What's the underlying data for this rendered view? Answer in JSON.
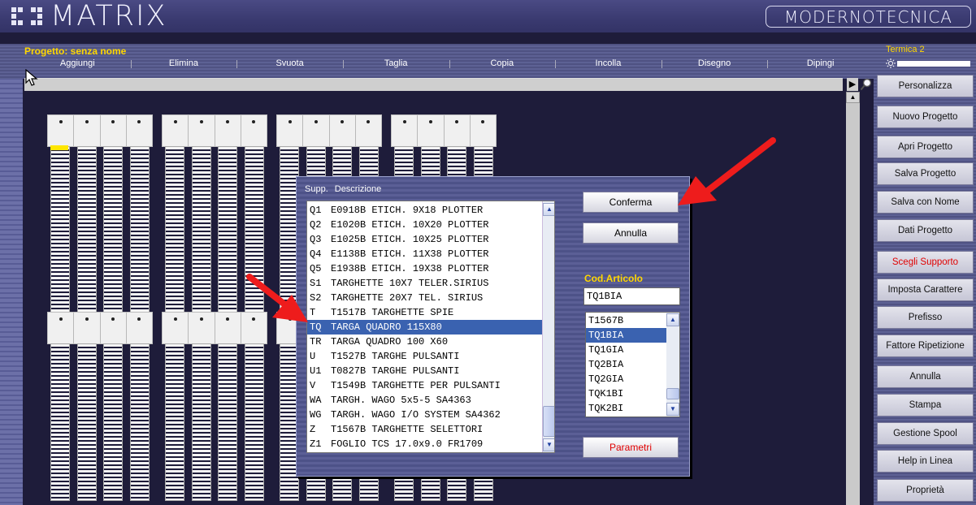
{
  "header": {
    "logo": "MATRIX",
    "brand": "MODERNOTECNICA"
  },
  "project": {
    "title": "Progetto: senza nome"
  },
  "menu": [
    "Aggiungi",
    "Elimina",
    "Svuota",
    "Taglia",
    "Copia",
    "Incolla",
    "Disegno",
    "Dipingi"
  ],
  "right_panel": {
    "title": "Termica 2",
    "buttons": [
      {
        "label": "Personalizza",
        "red": false
      },
      {
        "label": "Nuovo Progetto",
        "red": false
      },
      {
        "label": "Apri Progetto",
        "red": false
      },
      {
        "label": "Salva Progetto",
        "red": false
      },
      {
        "label": "Salva con Nome",
        "red": false
      },
      {
        "label": "Dati Progetto",
        "red": false
      },
      {
        "label": "Scegli Supporto",
        "red": true
      },
      {
        "label": "Imposta Carattere",
        "red": false
      },
      {
        "label": "Prefisso",
        "red": false
      },
      {
        "label": "Fattore Ripetizione",
        "red": false
      },
      {
        "label": "Annulla",
        "red": false
      },
      {
        "label": "Stampa",
        "red": false
      },
      {
        "label": "Gestione Spool",
        "red": false
      },
      {
        "label": "Help in Linea",
        "red": false
      },
      {
        "label": "Proprietà",
        "red": false
      }
    ]
  },
  "dialog": {
    "col_supp": "Supp.",
    "col_desc": "Descrizione",
    "rows": [
      {
        "code": "Q1",
        "desc": "E0918B ETICH. 9X18 PLOTTER"
      },
      {
        "code": "Q2",
        "desc": "E1020B ETICH. 10X20 PLOTTER"
      },
      {
        "code": "Q3",
        "desc": "E1025B ETICH. 10X25 PLOTTER"
      },
      {
        "code": "Q4",
        "desc": "E1138B ETICH. 11X38 PLOTTER"
      },
      {
        "code": "Q5",
        "desc": "E1938B ETICH. 19X38 PLOTTER"
      },
      {
        "code": "S1",
        "desc": "TARGHETTE 10X7 TELER.SIRIUS"
      },
      {
        "code": "S2",
        "desc": "TARGHETTE 20X7 TEL. SIRIUS"
      },
      {
        "code": "T",
        "desc": "T1517B TARGHETTE SPIE"
      },
      {
        "code": "TQ",
        "desc": "TARGA QUADRO 115X80"
      },
      {
        "code": "TR",
        "desc": "TARGA QUADRO 100 X60"
      },
      {
        "code": "U",
        "desc": "T1527B TARGHE PULSANTI"
      },
      {
        "code": "U1",
        "desc": "T0827B TARGHE PULSANTI"
      },
      {
        "code": "V",
        "desc": "T1549B TARGHETTE PER PULSANTI"
      },
      {
        "code": "WA",
        "desc": "TARGH. WAGO 5x5-5 SA4363"
      },
      {
        "code": "WG",
        "desc": "TARGH. WAGO I/O SYSTEM SA4362"
      },
      {
        "code": "Z",
        "desc": "T1567B TARGHETTE SELETTORI"
      },
      {
        "code": "Z1",
        "desc": "FOGLIO TCS 17.0x9.0 FR1709"
      }
    ],
    "selected_row": "TQ",
    "confirm": "Conferma",
    "cancel": "Annulla",
    "params": "Parametri",
    "cod_label": "Cod.Articolo",
    "cod_value": "TQ1BIA",
    "cod_options": [
      "T1567B",
      "TQ1BIA",
      "TQ1GIA",
      "TQ2BIA",
      "TQ2GIA",
      "TQK1BI",
      "TQK2BI"
    ],
    "cod_selected": "TQ1BIA"
  },
  "colors": {
    "accent_yellow": "#ffd700",
    "selection_blue": "#3a62b0",
    "arrow_red": "#ee1c1c",
    "alert_red": "#e00000"
  },
  "icons": [
    "pointer-cursor-icon",
    "play-arrow-icon",
    "zoom-icon",
    "sun-icon",
    "scroll-up-icon",
    "scroll-down-icon"
  ]
}
